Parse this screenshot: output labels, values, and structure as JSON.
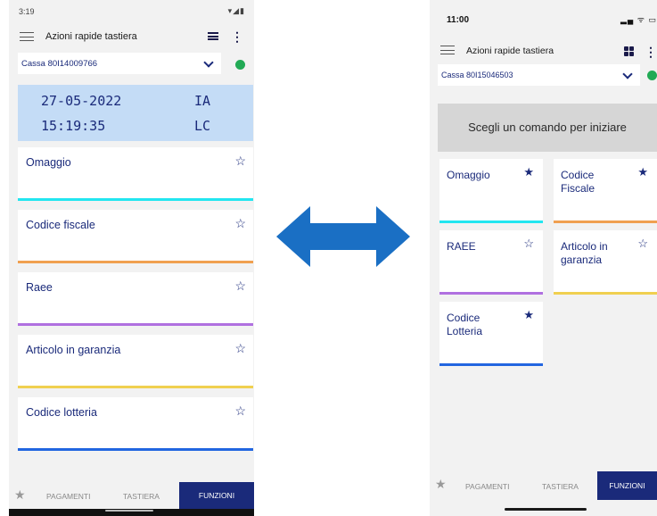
{
  "left": {
    "status": {
      "time": "3:19",
      "icons": "▾◢▮"
    },
    "appbar": {
      "title": "Azioni rapide tastiera"
    },
    "cassa": "Cassa 80I14009766",
    "display": {
      "date": "27-05-2022",
      "time": "15:19:35",
      "op1": "IA",
      "op2": "LC"
    },
    "commands": [
      {
        "label": "Omaggio",
        "star": "☆",
        "bar_color": "#22e6f0"
      },
      {
        "label": "Codice fiscale",
        "star": "☆",
        "bar_color": "#f0a050"
      },
      {
        "label": "Raee",
        "star": "☆",
        "bar_color": "#b070e0"
      },
      {
        "label": "Articolo in garanzia",
        "star": "☆",
        "bar_color": "#f0d050"
      },
      {
        "label": "Codice lotteria",
        "star": "☆",
        "bar_color": "#2266e0"
      }
    ],
    "nav": {
      "fav_icon": "★",
      "tab1": "PAGAMENTI",
      "tab2": "TASTIERA",
      "tab3": "FUNZIONI"
    }
  },
  "right": {
    "status": {
      "time": "11:00",
      "icons": "▂▄ ᯤ ▭"
    },
    "appbar": {
      "title": "Azioni rapide tastiera"
    },
    "cassa": "Cassa 80I15046503",
    "hint": "Scegli un comando per iniziare",
    "tiles": [
      {
        "label": "Omaggio",
        "star": "★",
        "bar_color": "#22e6f0"
      },
      {
        "label": "Codice Fiscale",
        "star": "★",
        "bar_color": "#f0a050"
      },
      {
        "label": "RAEE",
        "star": "☆",
        "bar_color": "#b070e0"
      },
      {
        "label": "Articolo in garanzia",
        "star": "☆",
        "bar_color": "#f0d050"
      },
      {
        "label": "Codice Lotteria",
        "star": "★",
        "bar_color": "#2266e0"
      }
    ],
    "nav": {
      "fav_icon": "★",
      "tab1": "PAGAMENTI",
      "tab2": "TASTIERA",
      "tab3": "FUNZIONI"
    }
  },
  "colors": {
    "accent": "#1a2a7a",
    "arrow": "#1a6fc4",
    "status_ok": "#22aa55"
  }
}
